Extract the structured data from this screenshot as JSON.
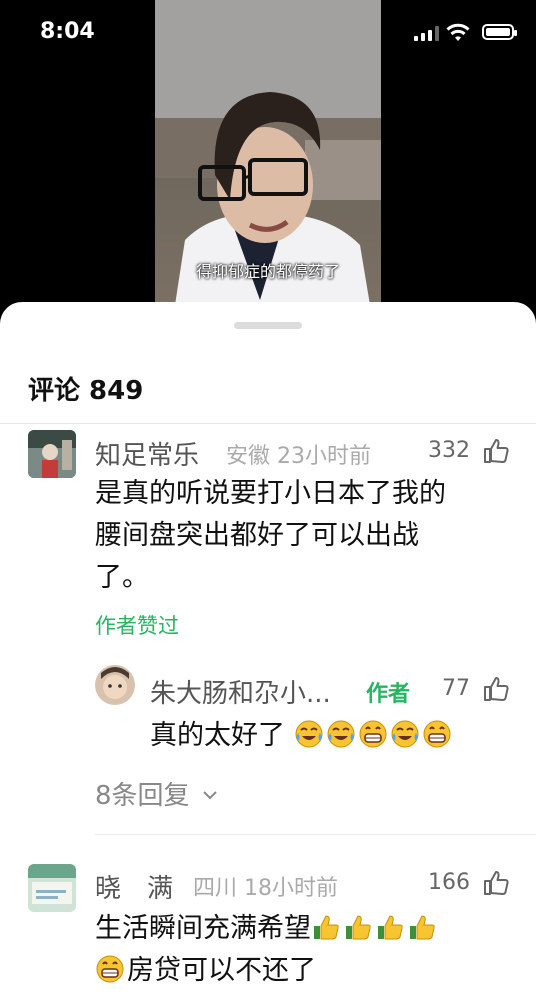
{
  "status_bar": {
    "time": "8:04"
  },
  "video": {
    "subtitle": "得抑郁症的都停药了"
  },
  "comments_panel": {
    "title": "评论 849",
    "comments": [
      {
        "username": "知足常乐",
        "meta": "安徽 23小时前",
        "likes": "332",
        "text_line1": "是真的听说要打小日本了我的",
        "text_line2": "腰间盘突出都好了可以出战",
        "text_line3": "了。",
        "author_liked": "作者赞过",
        "reply": {
          "username": "朱大肠和尕小...",
          "tag": "作者",
          "likes": "77",
          "text": "真的太好了",
          "emojis": [
            "laugh-cry-emoji",
            "laugh-cry-emoji",
            "grin-emoji",
            "laugh-cry-emoji",
            "grin-emoji"
          ]
        },
        "replies_toggle": "8条回复"
      },
      {
        "username": "晓　满",
        "meta": "四川 18小时前",
        "likes": "166",
        "text_line1": "生活瞬间充满希望",
        "text_line2": "房贷可以不还了",
        "emojis_line1": [
          "thumbs-up-emoji",
          "thumbs-up-emoji",
          "thumbs-up-emoji",
          "thumbs-up-emoji"
        ],
        "emojis_line2": [
          "grin-emoji"
        ]
      }
    ]
  },
  "colors": {
    "accent_green": "#28b463",
    "sheet_bg": "#ffffff",
    "background": "#000000"
  }
}
